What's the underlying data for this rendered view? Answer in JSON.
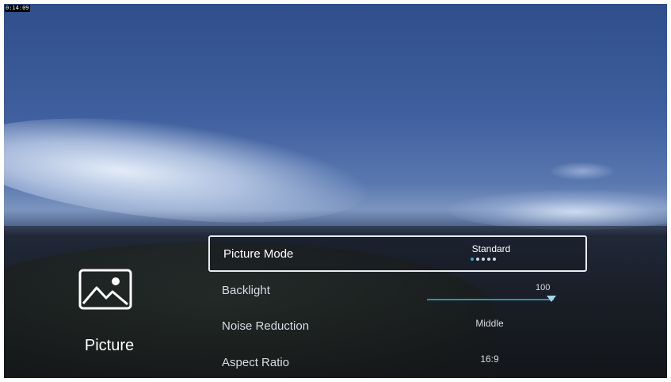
{
  "status": {
    "timestamp": "0:14:09"
  },
  "category": {
    "icon": "picture-icon",
    "label": "Picture"
  },
  "menu": {
    "picture_mode": {
      "label": "Picture Mode",
      "value": "Standard",
      "option_count": 5,
      "selected_index": 1
    },
    "backlight": {
      "label": "Backlight",
      "value": "100",
      "level": 1.0
    },
    "noise_reduction": {
      "label": "Noise Reduction",
      "value": "Middle"
    },
    "aspect_ratio": {
      "label": "Aspect Ratio",
      "value": "16:9"
    }
  },
  "colors": {
    "accent": "#3aa6d9",
    "selection_border": "#e8ebf0",
    "text": "#d7dbe3"
  }
}
